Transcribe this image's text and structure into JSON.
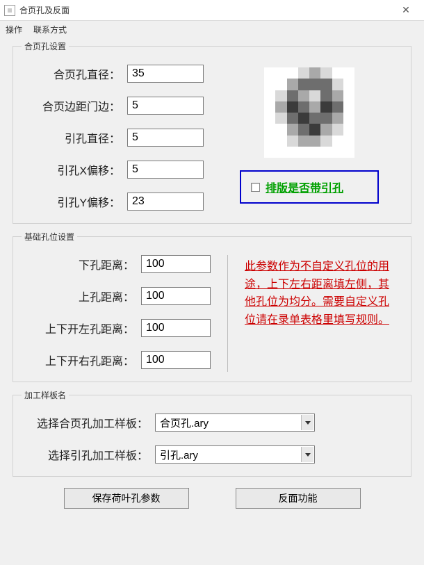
{
  "window": {
    "title": "合页孔及反面",
    "close_glyph": "✕"
  },
  "menu": {
    "m1": "操作",
    "m2": "联系方式"
  },
  "group1": {
    "legend": "合页孔设置",
    "labels": {
      "diameter": "合页孔直径：",
      "edge": "合页边距门边：",
      "pilot_dia": "引孔直径：",
      "pilot_x": "引孔X偏移：",
      "pilot_y": "引孔Y偏移："
    },
    "values": {
      "diameter": "35",
      "edge": "5",
      "pilot_dia": "5",
      "pilot_x": "5",
      "pilot_y": "23"
    },
    "checkbox_label": "排版是否带引孔"
  },
  "group2": {
    "legend": "基础孔位设置",
    "labels": {
      "down": "下孔距离：",
      "up": "上孔距离：",
      "ud_left": "上下开左孔距离：",
      "ud_right": "上下开右孔距离："
    },
    "values": {
      "down": "100",
      "up": "100",
      "ud_left": "100",
      "ud_right": "100"
    },
    "note": "此参数作为不自定义孔位的用途，上下左右距离填左侧，其他孔位为均分。需要自定义孔位请在录单表格里填写规则。"
  },
  "group3": {
    "legend": "加工样板名",
    "labels": {
      "tpl_hinge": "选择合页孔加工样板：",
      "tpl_pilot": "选择引孔加工样板："
    },
    "values": {
      "tpl_hinge": "合页孔.ary",
      "tpl_pilot": "引孔.ary"
    }
  },
  "buttons": {
    "save": "保存荷叶孔参数",
    "reverse": "反面功能"
  }
}
